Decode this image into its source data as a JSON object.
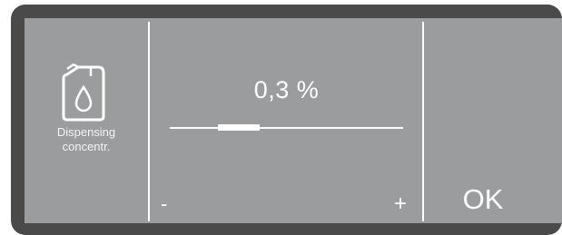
{
  "menu": {
    "icon": "canister-drop-icon",
    "label_line1": "Dispensing",
    "label_line2": "concentr."
  },
  "setting": {
    "value_text": "0,3 %",
    "slider_fraction": 0.25
  },
  "controls": {
    "minus_label": "-",
    "plus_label": "+",
    "ok_label": "OK"
  },
  "colors": {
    "bezel": "#4a4a4a",
    "screen": "#9b9c9e",
    "foreground": "#ffffff"
  }
}
